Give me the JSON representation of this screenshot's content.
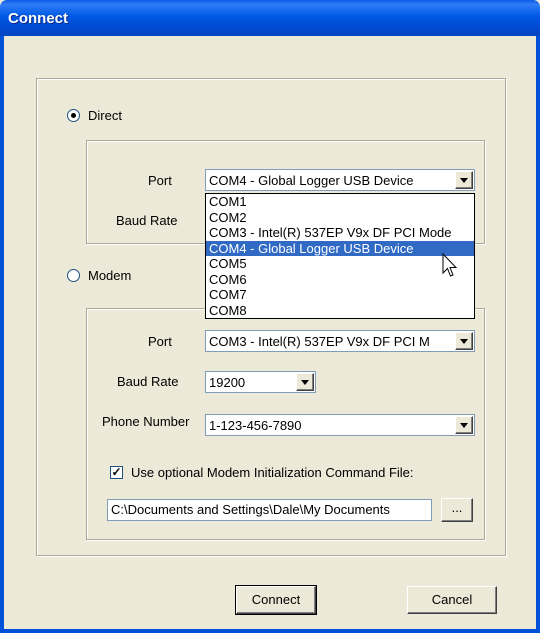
{
  "window": {
    "title": "Connect"
  },
  "direct": {
    "label": "Direct",
    "selected": true,
    "port_label": "Port",
    "port_value": "COM4 - Global Logger USB Device",
    "baud_label": "Baud Rate"
  },
  "port_dropdown": {
    "options": [
      "COM1",
      "COM2",
      "COM3 - Intel(R) 537EP V9x DF PCI Mode",
      "COM4 - Global Logger USB Device",
      "COM5",
      "COM6",
      "COM7",
      "COM8"
    ],
    "selected_index": 3
  },
  "modem": {
    "label": "Modem",
    "selected": false,
    "port_label": "Port",
    "port_value": "COM3 - Intel(R) 537EP V9x DF PCI M",
    "baud_label": "Baud Rate",
    "baud_value": "19200",
    "phone_label": "Phone Number",
    "phone_value": "1-123-456-7890",
    "init_checkbox_label": "Use optional Modem Initialization Command File:",
    "init_checked": true,
    "init_path": "C:\\Documents and Settings\\Dale\\My Documents",
    "browse_label": "..."
  },
  "buttons": {
    "connect": "Connect",
    "cancel": "Cancel"
  },
  "colors": {
    "titlebar": "#0058e4",
    "selection": "#316AC5",
    "dialog_bg": "#ECE9D8"
  }
}
